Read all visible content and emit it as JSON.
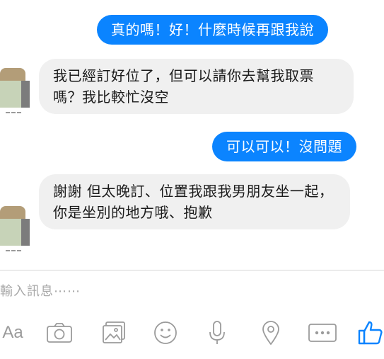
{
  "messages": [
    {
      "from": "me",
      "text": "真的嗎！好！什麼時候再跟我說"
    },
    {
      "from": "other",
      "text": "我已經訂好位了，但可以請你去幫我取票嗎？我比較忙沒空"
    },
    {
      "from": "me",
      "text": "可以可以！沒問題"
    },
    {
      "from": "other",
      "text": "謝謝 但太晚訂、位置我跟我男朋友坐一起，你是坐別的地方哦、抱歉"
    }
  ],
  "composer": {
    "placeholder": "輸入訊息⋯⋯",
    "font_button": "Aa"
  },
  "toolbar_icons": [
    "font-button",
    "camera-icon",
    "gallery-icon",
    "emoji-icon",
    "microphone-icon",
    "location-icon",
    "more-icon",
    "thumbs-up-icon"
  ],
  "colors": {
    "outgoing": "#0b84ff",
    "incoming": "#f0f0f0",
    "like": "#0b84ff",
    "icons": "#9b9b9b"
  }
}
